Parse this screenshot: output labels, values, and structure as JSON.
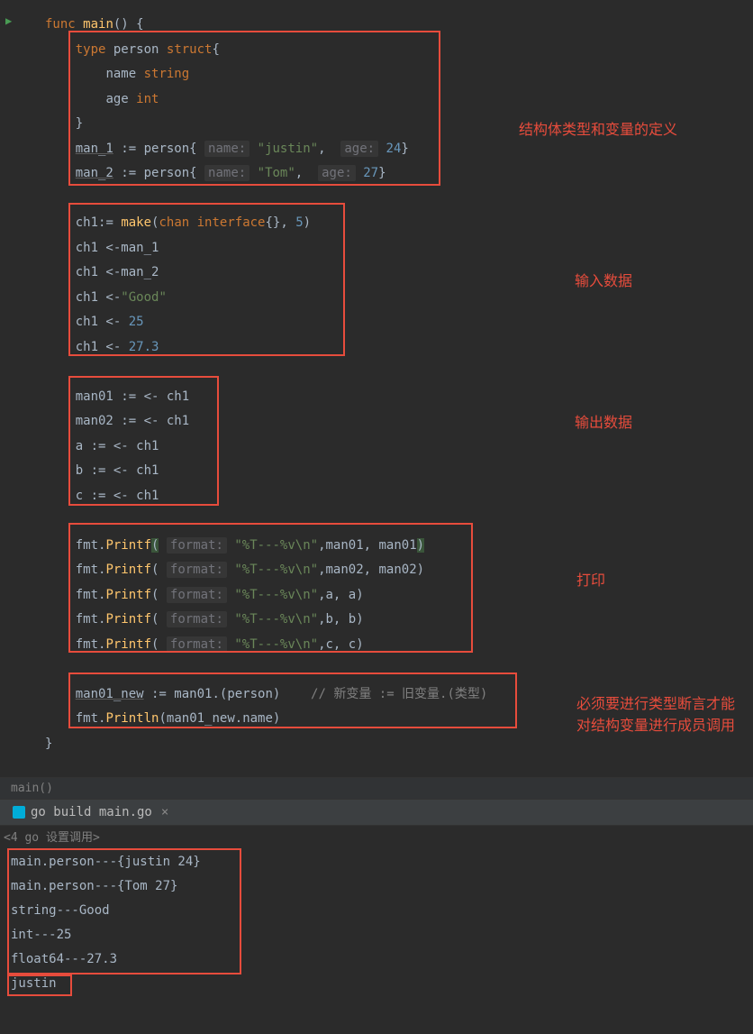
{
  "code": {
    "line1_func": "func",
    "line1_main": "main",
    "line1_rest": "() {",
    "line2_type": "type",
    "line2_person": "person",
    "line2_struct": "struct",
    "line2_brace": "{",
    "line3_name": "name",
    "line3_string": "string",
    "line4_age": "age",
    "line4_int": "int",
    "line5": "}",
    "line6_man1": "man_1",
    "line6_assign": " := ",
    "line6_person": "person",
    "line6_brace": "{",
    "line6_nameparam": "name:",
    "line6_justin": "\"justin\"",
    "line6_comma": ",",
    "line6_ageparam": "age:",
    "line6_24": "24",
    "line6_close": "}",
    "line7_man2": "man_2",
    "line7_tom": "\"Tom\"",
    "line7_27": "27",
    "line9_ch1": "ch1",
    "line9_make": "make",
    "line9_chan": "chan",
    "line9_interface": "interface",
    "line9_5": "5",
    "line10": "ch1 <-man_1",
    "line11": "ch1 <-man_2",
    "line12_pre": "ch1 <-",
    "line12_good": "\"Good\"",
    "line13_pre": "ch1 <- ",
    "line13_25": "25",
    "line14_273": "27.3",
    "line16": "man01 := <- ch1",
    "line17": "man02 := <- ch1",
    "line18": "a := <- ch1",
    "line19": "b := <- ch1",
    "line20": "c := <- ch1",
    "line22_fmt": "fmt",
    "line22_printf": "Printf",
    "line22_format": "format:",
    "line22_fmtstr": "\"%T---%v\\n\"",
    "line22_args": ",man01, man01",
    "line23_args": ",man02, man02",
    "line24_args": ",a, a",
    "line25_args": ",b, b",
    "line26_args": ",c, c",
    "line28_man01new": "man01_new",
    "line28_man01": "man01",
    "line28_person": "person",
    "line28_comment": "// 新变量 := 旧变量.(类型)",
    "line29_println": "Println",
    "line29_arg": "man01_new.name"
  },
  "annotations": {
    "ann1": "结构体类型和变量的定义",
    "ann2": "输入数据",
    "ann3": "输出数据",
    "ann4": "打印",
    "ann5": "必须要进行类型断言才能对结构变量进行成员调用"
  },
  "breadcrumb": "main()",
  "tab": {
    "label": "go build main.go"
  },
  "debug_bar": "<4 go 设置调用>",
  "console": {
    "line1": "main.person---{justin 24}",
    "line2": "main.person---{Tom 27}",
    "line3": "string---Good",
    "line4": "int---25",
    "line5": "float64---27.3",
    "line6": "justin"
  }
}
